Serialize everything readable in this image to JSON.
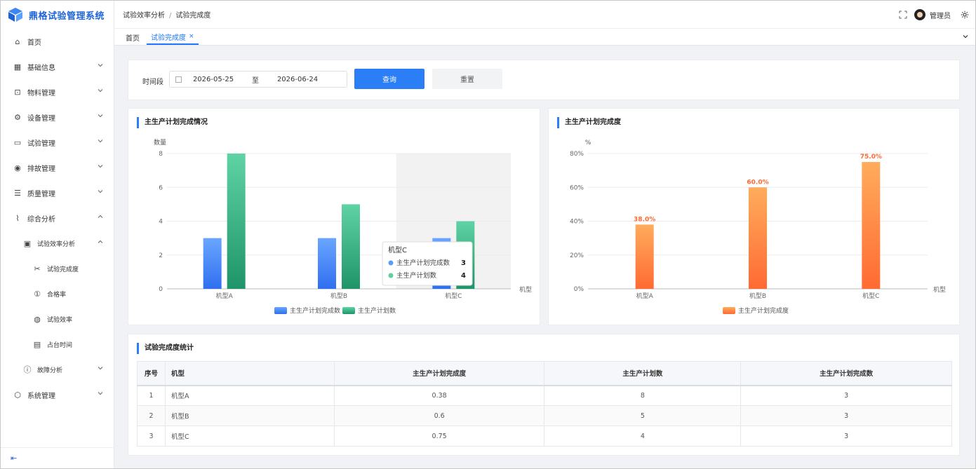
{
  "app": {
    "title": "鼎格试验管理系统"
  },
  "sidebar": {
    "items": [
      {
        "label": "首页",
        "icon": "home-icon"
      },
      {
        "label": "基础信息",
        "icon": "grid-icon"
      },
      {
        "label": "物料管理",
        "icon": "box-icon"
      },
      {
        "label": "设备管理",
        "icon": "device-icon"
      },
      {
        "label": "试验管理",
        "icon": "test-icon"
      },
      {
        "label": "排故管理",
        "icon": "target-icon"
      },
      {
        "label": "质量管理",
        "icon": "list-icon"
      },
      {
        "label": "综合分析",
        "icon": "chart-icon"
      },
      {
        "label": "试验效率分析",
        "icon": "monitor-icon"
      },
      {
        "label": "试验完成度",
        "icon": "tools-icon"
      },
      {
        "label": "合格率",
        "icon": "badge-icon"
      },
      {
        "label": "试验效率",
        "icon": "globe-icon"
      },
      {
        "label": "占台时间",
        "icon": "calendar-icon"
      },
      {
        "label": "故障分析",
        "icon": "warning-icon"
      },
      {
        "label": "系统管理",
        "icon": "settings-icon"
      }
    ],
    "collapse_glyph": "⇤"
  },
  "header": {
    "breadcrumb": [
      "试验效率分析",
      "试验完成度"
    ],
    "breadcrumb_sep": "/",
    "user": "管理员"
  },
  "tabs": [
    {
      "label": "首页",
      "active": false
    },
    {
      "label": "试验完成度",
      "active": true,
      "close": "×"
    }
  ],
  "filter": {
    "label": "时间段",
    "start": "2026-05-25",
    "sep": "至",
    "end": "2026-06-24",
    "query_label": "查询",
    "reset_label": "重置"
  },
  "chart1_title": "主生产计划完成情况",
  "chart2_title": "主生产计划完成度",
  "chart_data": [
    {
      "type": "bar",
      "title": "主生产计划完成情况",
      "ylabel": "数量",
      "xlabel": "机型",
      "categories": [
        "机型A",
        "机型B",
        "机型C"
      ],
      "ylim": [
        0,
        8
      ],
      "yticks": [
        0,
        2,
        4,
        6,
        8
      ],
      "series": [
        {
          "name": "主生产计划完成数",
          "values": [
            3,
            3,
            3
          ],
          "color": "#3a7cf5"
        },
        {
          "name": "主生产计划数",
          "values": [
            8,
            5,
            4
          ],
          "color": "#2aa87a"
        }
      ],
      "legend": "bottom",
      "grid": true,
      "highlight": "机型C",
      "tooltip": {
        "title": "机型C",
        "rows": [
          {
            "name": "主生产计划完成数",
            "value": "3"
          },
          {
            "name": "主生产计划数",
            "value": "4"
          }
        ]
      }
    },
    {
      "type": "bar",
      "title": "主生产计划完成度",
      "ylabel": "%",
      "xlabel": "机型",
      "categories": [
        "机型A",
        "机型B",
        "机型C"
      ],
      "ylim": [
        0,
        80
      ],
      "yticks": [
        "0%",
        "20%",
        "40%",
        "60%",
        "80%"
      ],
      "series": [
        {
          "name": "主生产计划完成度",
          "values": [
            38,
            60,
            75
          ],
          "labels": [
            "38.0%",
            "60.0%",
            "75.0%"
          ],
          "color": "#ff7a3d"
        }
      ],
      "legend": "bottom",
      "grid": true
    }
  ],
  "table": {
    "title": "试验完成度统计",
    "headers": [
      "序号",
      "机型",
      "主生产计划完成度",
      "主生产计划数",
      "主生产计划完成数"
    ],
    "rows": [
      [
        "1",
        "机型A",
        "0.38",
        "8",
        "3"
      ],
      [
        "2",
        "机型B",
        "0.6",
        "5",
        "3"
      ],
      [
        "3",
        "机型C",
        "0.75",
        "4",
        "3"
      ]
    ]
  }
}
